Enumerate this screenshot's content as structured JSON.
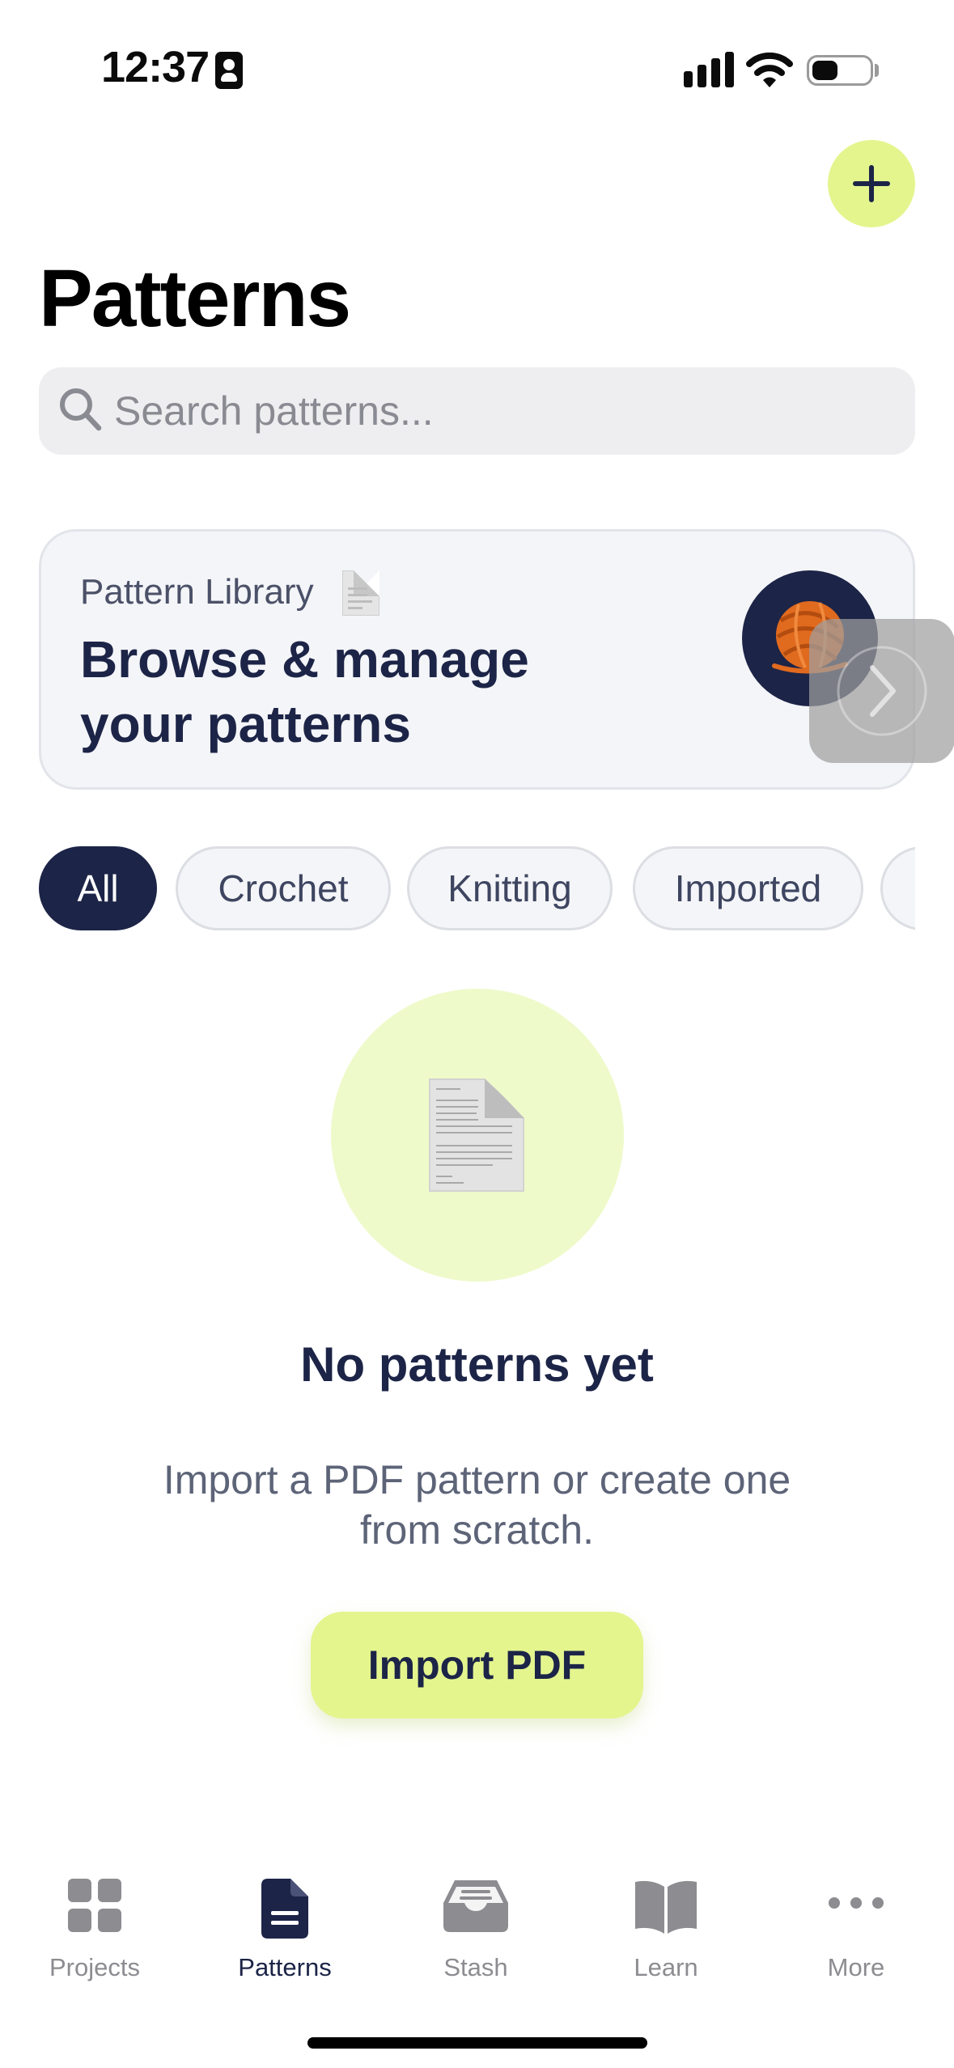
{
  "status_bar": {
    "time": "12:37",
    "icons": [
      "contact-card-icon",
      "cellular-signal-icon",
      "wifi-icon",
      "battery-icon"
    ],
    "battery_level": 0.45
  },
  "header": {
    "title": "Patterns",
    "add_icon": "plus-icon"
  },
  "search": {
    "placeholder": "Search patterns...",
    "value": "",
    "icon": "search-icon"
  },
  "library_card": {
    "kicker": "Pattern Library",
    "kicker_icon": "document-icon",
    "headline": "Browse & manage your patterns",
    "avatar_icon": "yarn-ball-icon",
    "avatar_bg": "#1c2447"
  },
  "filters": {
    "selected": "All",
    "items": [
      "All",
      "Crochet",
      "Knitting",
      "Imported"
    ]
  },
  "empty_state": {
    "icon": "document-icon",
    "title": "No patterns yet",
    "body": "Import a PDF pattern or create one from scratch.",
    "button_label": "Import PDF"
  },
  "tab_bar": {
    "active": "Patterns",
    "items": [
      {
        "label": "Projects",
        "icon": "grid-icon"
      },
      {
        "label": "Patterns",
        "icon": "document-icon"
      },
      {
        "label": "Stash",
        "icon": "tray-icon"
      },
      {
        "label": "Learn",
        "icon": "book-icon"
      },
      {
        "label": "More",
        "icon": "ellipsis-icon"
      }
    ]
  },
  "colors": {
    "accent": "#e4f58e",
    "navy": "#1c2447",
    "empty_circle": "#eefaca",
    "inactive_tab": "#8c8c91"
  }
}
